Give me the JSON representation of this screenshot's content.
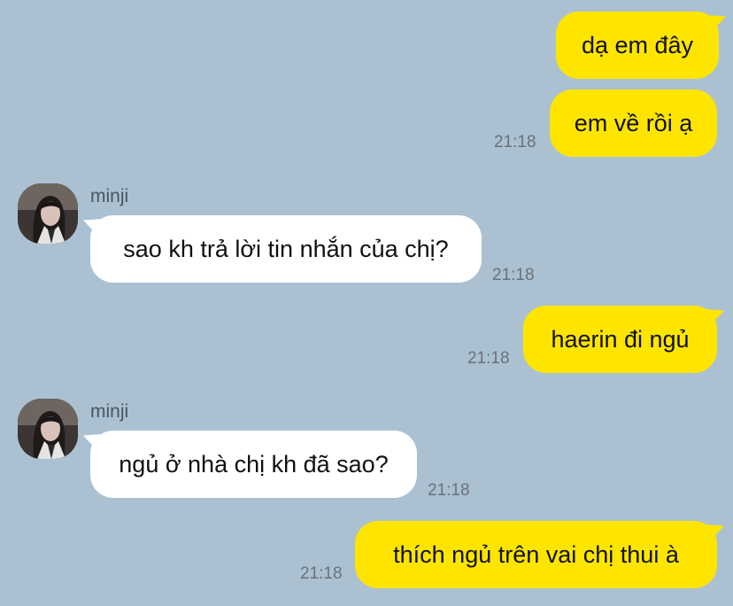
{
  "chat": {
    "messages": [
      {
        "sender": "me",
        "text": "dạ em đây",
        "time": ""
      },
      {
        "sender": "me",
        "text": "em về rồi ạ",
        "time": "21:18"
      },
      {
        "sender": "minji",
        "text": "sao kh trả lời tin nhắn của chị?",
        "time": "21:18"
      },
      {
        "sender": "me",
        "text": "haerin đi ngủ",
        "time": "21:18"
      },
      {
        "sender": "minji",
        "text": "ngủ ở nhà chị kh đã sao?",
        "time": "21:18"
      },
      {
        "sender": "me",
        "text": "thích ngủ trên vai chị thui à",
        "time": "21:18"
      }
    ],
    "contact": {
      "name": "minji"
    }
  },
  "colors": {
    "background": "#abc1d1",
    "my_bubble": "#fee500",
    "their_bubble": "#ffffff",
    "timestamp": "#6a7179"
  },
  "icons": {
    "avatar": "contact-avatar-photo"
  }
}
